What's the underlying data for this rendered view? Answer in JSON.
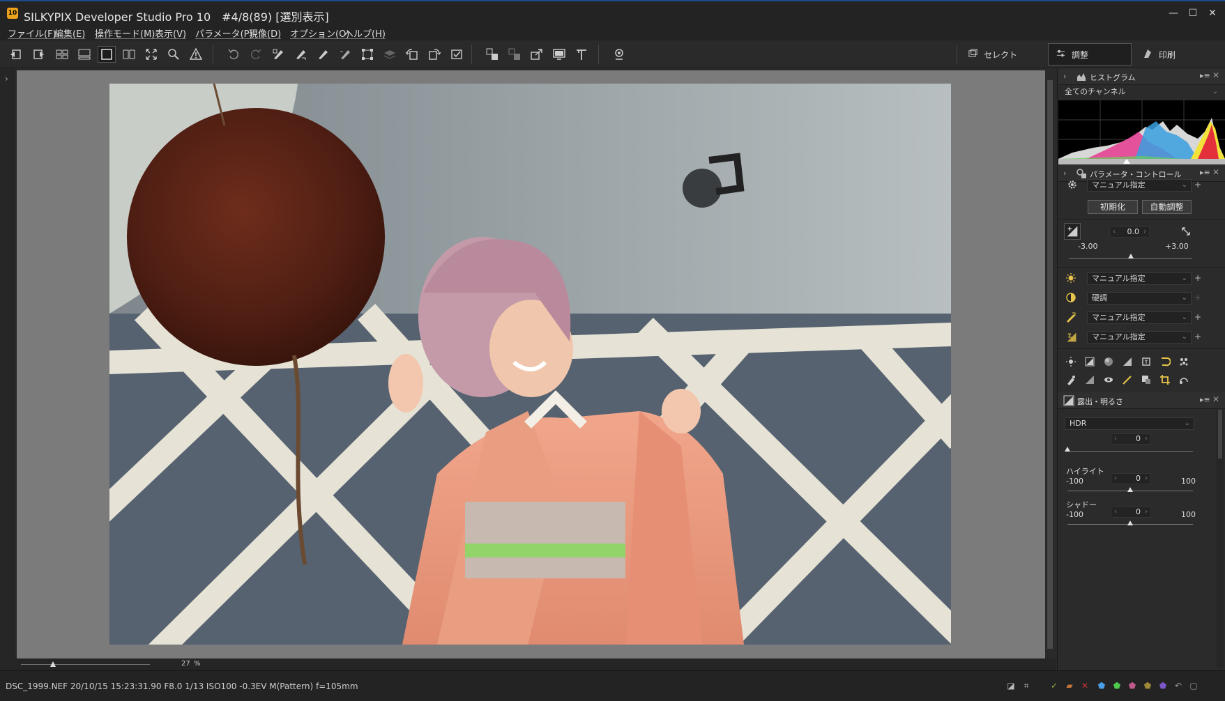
{
  "window": {
    "app_icon_text": "10",
    "title": "SILKYPIX Developer Studio Pro 10　#4/8(89) [選別表示]",
    "minimize": "—",
    "maximize": "☐",
    "close": "✕"
  },
  "menu": {
    "items": [
      "ファイル(F)",
      "編集(E)",
      "操作モード(M)",
      "表示(V)",
      "パラメータ(P)",
      "現像(D)",
      "オプション(O)",
      "ヘルプ(H)"
    ]
  },
  "modes": {
    "select_label": "セレクト",
    "adjust_label": "調整",
    "print_label": "印刷"
  },
  "viewer": {
    "zoom_value": "27",
    "zoom_unit": "%"
  },
  "status": {
    "text": "DSC_1999.NEF 20/10/15 15:23:31.90 F8.0 1/13 ISO100 -0.3EV M(Pattern) f=105mm"
  },
  "panels": {
    "histogram": {
      "title": "ヒストグラム",
      "channel": "全てのチャンネル",
      "menu_icon": "▸≡",
      "close": "✕"
    },
    "param": {
      "title": "パラメータ・コントロール",
      "taste": "マニュアル指定",
      "reset_btn": "初期化",
      "auto_btn": "自動調整",
      "exposure_value": "0.0",
      "exposure_min": "-3.00",
      "exposure_max": "+3.00",
      "exposure_level": 0.0,
      "wb": "マニュアル指定",
      "tone": "硬調",
      "sharp": "マニュアル指定",
      "color": "マニュアル指定",
      "plus": "+"
    },
    "exposure": {
      "title": "露出・明るさ",
      "mode": "HDR",
      "hdr_value": "0",
      "highlight_label": "ハイライト",
      "highlight_value": "0",
      "highlight_min": "-100",
      "highlight_max": "100",
      "shadow_label": "シャドー",
      "shadow_value": "0",
      "shadow_min": "-100",
      "shadow_max": "100"
    }
  },
  "colors": {
    "accent": "#1e4d8b",
    "panel_bg": "#2b2b2b",
    "viewer_bg": "#7b7b7b"
  }
}
